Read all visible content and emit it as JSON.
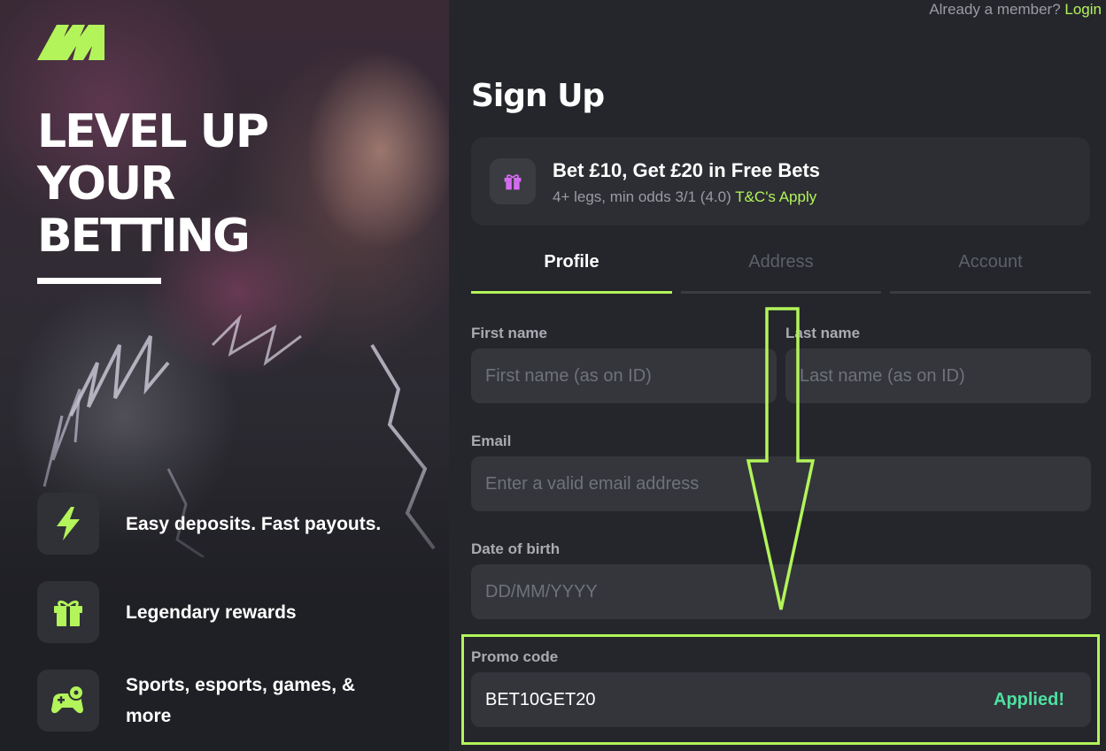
{
  "header": {
    "already_member": "Already a member?",
    "login_link": "Login"
  },
  "hero": {
    "headline": [
      "LEVEL UP",
      "YOUR",
      "BETTING"
    ],
    "features": [
      {
        "icon": "lightning-icon",
        "label": "Easy deposits. Fast payouts."
      },
      {
        "icon": "gift-icon",
        "label": "Legendary rewards"
      },
      {
        "icon": "gamepad-ball-icon",
        "label": "Sports, esports, games, & more"
      }
    ]
  },
  "signup": {
    "title": "Sign Up",
    "offer": {
      "title": "Bet £10, Get £20 in Free Bets",
      "subtitle": "4+ legs, min odds 3/1 (4.0)",
      "terms_link": "T&C's Apply"
    },
    "tabs": [
      {
        "label": "Profile",
        "active": true
      },
      {
        "label": "Address",
        "active": false
      },
      {
        "label": "Account",
        "active": false
      }
    ],
    "fields": {
      "first_name": {
        "label": "First name",
        "placeholder": "First name (as on ID)",
        "value": ""
      },
      "last_name": {
        "label": "Last name",
        "placeholder": "Last name (as on ID)",
        "value": ""
      },
      "email": {
        "label": "Email",
        "placeholder": "Enter a valid email address",
        "value": ""
      },
      "dob": {
        "label": "Date of birth",
        "placeholder": "DD/MM/YYYY",
        "value": ""
      },
      "promo": {
        "label": "Promo code",
        "value": "BET10GET20",
        "status": "Applied!"
      }
    }
  },
  "colors": {
    "accent": "#b3f45a",
    "applied": "#4ee0a0",
    "background": "#24262b",
    "field": "#34363c"
  }
}
